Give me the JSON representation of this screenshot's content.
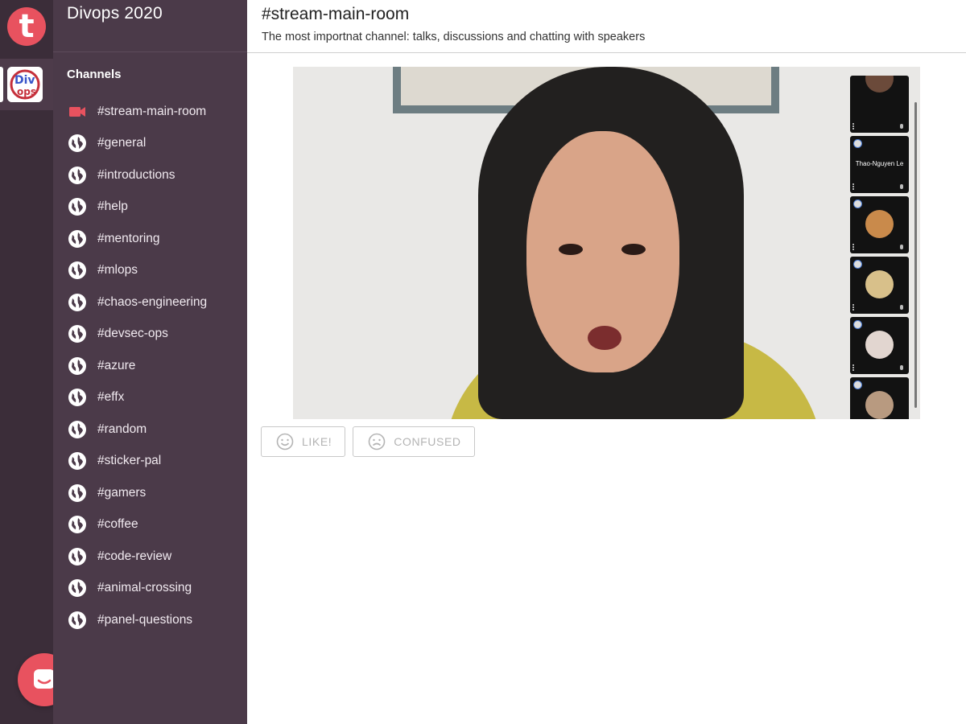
{
  "app": {
    "logo_letter": "t",
    "workspace_title": "Divops 2020",
    "workspace_icon_text": "Div ops"
  },
  "sidebar": {
    "heading": "Channels",
    "channels": [
      {
        "label": "#stream-main-room",
        "icon": "video-camera-icon",
        "active": true
      },
      {
        "label": "#general",
        "icon": "globe-icon"
      },
      {
        "label": "#introductions",
        "icon": "globe-icon"
      },
      {
        "label": "#help",
        "icon": "globe-icon"
      },
      {
        "label": "#mentoring",
        "icon": "globe-icon"
      },
      {
        "label": "#mlops",
        "icon": "globe-icon"
      },
      {
        "label": "#chaos-engineering",
        "icon": "globe-icon"
      },
      {
        "label": "#devsec-ops",
        "icon": "globe-icon"
      },
      {
        "label": "#azure",
        "icon": "globe-icon"
      },
      {
        "label": "#effx",
        "icon": "globe-icon"
      },
      {
        "label": "#random",
        "icon": "globe-icon"
      },
      {
        "label": "#sticker-pal",
        "icon": "globe-icon"
      },
      {
        "label": "#gamers",
        "icon": "globe-icon"
      },
      {
        "label": "#coffee",
        "icon": "globe-icon"
      },
      {
        "label": "#code-review",
        "icon": "globe-icon"
      },
      {
        "label": "#animal-crossing",
        "icon": "globe-icon"
      },
      {
        "label": "#panel-questions",
        "icon": "globe-icon"
      }
    ]
  },
  "channel": {
    "title": "#stream-main-room",
    "description": "The most importnat channel: talks, discussions and chatting with speakers"
  },
  "video": {
    "participants": [
      {
        "label": ""
      },
      {
        "label": "Thao-Nguyen Le"
      },
      {
        "label": ""
      },
      {
        "label": ""
      },
      {
        "label": ""
      },
      {
        "label": ""
      }
    ]
  },
  "reactions": {
    "like_label": "LIKE!",
    "confused_label": "CONFUSED"
  },
  "colors": {
    "accent": "#e8525f",
    "sidebar_bg": "#4b3a49",
    "rail_bg": "#3b2d39"
  }
}
